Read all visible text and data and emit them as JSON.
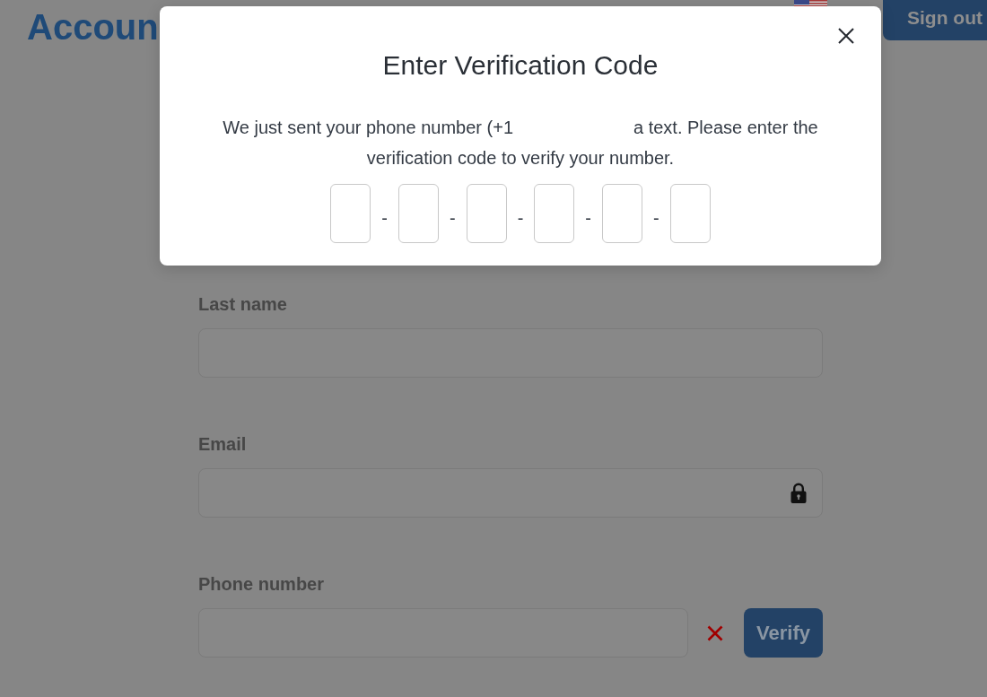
{
  "header": {
    "title": "Accoun",
    "sign_out": "Sign out"
  },
  "form": {
    "fields": [
      {
        "label": "Last name",
        "kind": "text",
        "locked": false
      },
      {
        "label": "Email",
        "kind": "text",
        "locked": true
      },
      {
        "label": "Phone number",
        "kind": "phone",
        "locked": false,
        "verified": false,
        "button": "Verify"
      }
    ]
  },
  "modal": {
    "title": "Enter Verification Code",
    "message_lines": [
      {
        "segments": [
          "We just sent your phone number (+1",
          "a text. Please enter the"
        ]
      },
      {
        "segments": [
          "verification code to verify your number."
        ]
      }
    ],
    "code_row": [
      {
        "kind": "box"
      },
      {
        "kind": "separator",
        "text": "-"
      },
      {
        "kind": "box"
      },
      {
        "kind": "separator",
        "text": "-"
      },
      {
        "kind": "box"
      },
      {
        "kind": "separator",
        "text": "-"
      },
      {
        "kind": "box"
      },
      {
        "kind": "separator",
        "text": "-"
      },
      {
        "kind": "box"
      },
      {
        "kind": "separator",
        "text": "-"
      },
      {
        "kind": "box"
      }
    ]
  }
}
